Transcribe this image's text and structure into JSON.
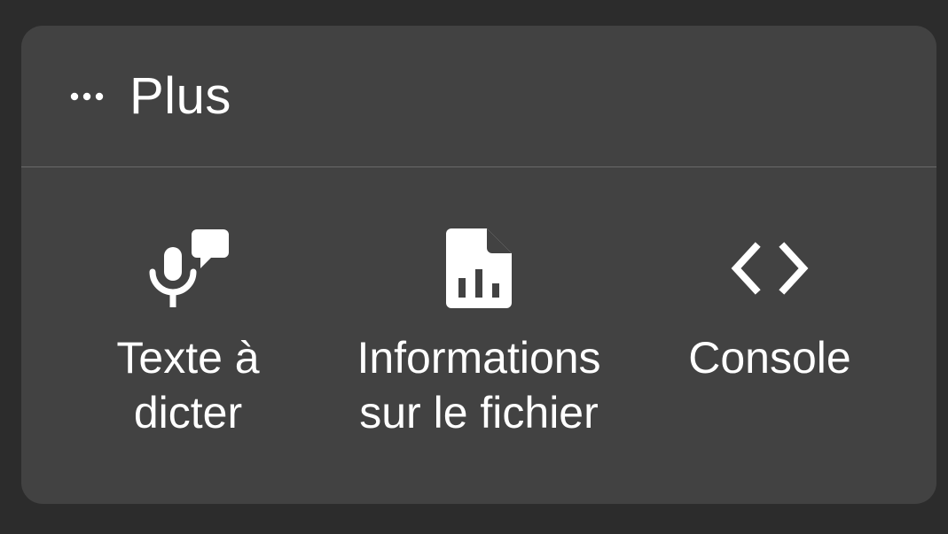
{
  "header": {
    "title": "Plus",
    "icon": "more-horizontal-icon"
  },
  "actions": [
    {
      "label": "Texte à\ndicter",
      "icon": "mic-speech-icon"
    },
    {
      "label": "Informations\nsur le fichier",
      "icon": "file-chart-icon"
    },
    {
      "label": "Console",
      "icon": "code-brackets-icon"
    }
  ],
  "colors": {
    "background": "#2c2c2c",
    "panel": "#424242",
    "divider": "#6a6a6a",
    "foreground": "#ffffff"
  }
}
